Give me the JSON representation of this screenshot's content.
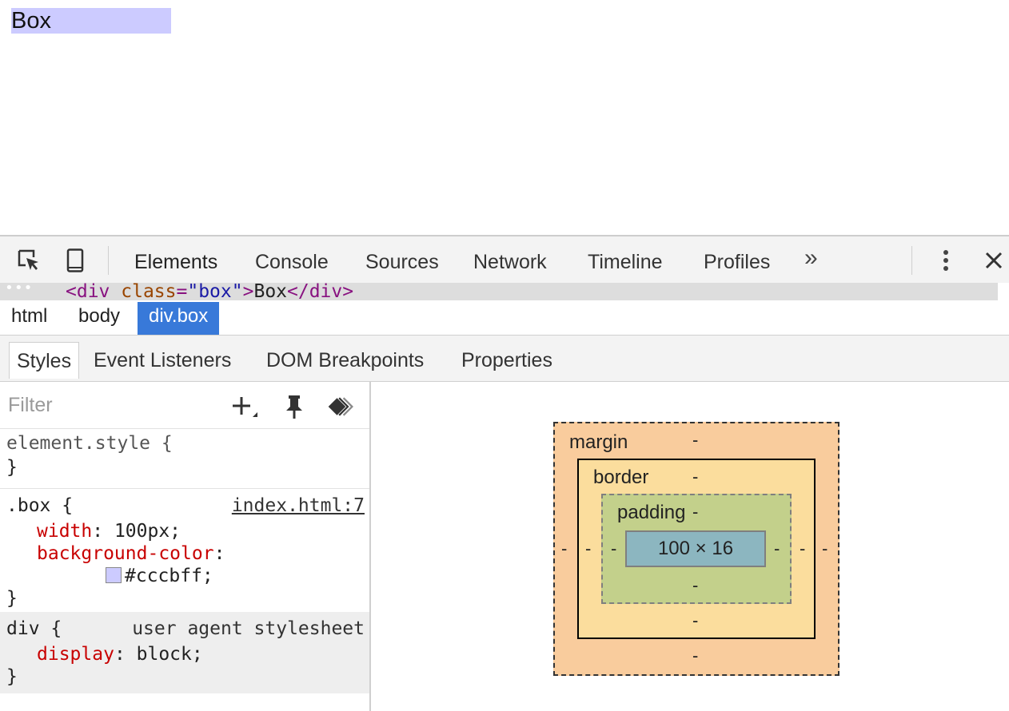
{
  "page": {
    "box_text": "Box",
    "box_color": "#cccbff"
  },
  "toolbar": {
    "inspect_icon": "inspect-element-icon",
    "device_icon": "device-mode-icon",
    "tabs": [
      {
        "label": "Elements",
        "active": true
      },
      {
        "label": "Console"
      },
      {
        "label": "Sources"
      },
      {
        "label": "Network"
      },
      {
        "label": "Timeline"
      },
      {
        "label": "Profiles"
      }
    ],
    "more_label": "»",
    "menu_icon": "vertical-dots-icon",
    "close_icon": "close-icon"
  },
  "dom": {
    "dots": "•••",
    "open_tag": "<div",
    "attr_name": "class",
    "eq": "=",
    "attr_value": "\"box\"",
    "close_bracket": ">",
    "text": "Box",
    "end_tag": "</div>"
  },
  "breadcrumbs": [
    "html",
    "body",
    "div.box"
  ],
  "subtabs": [
    {
      "label": "Styles",
      "active": true
    },
    {
      "label": "Event Listeners"
    },
    {
      "label": "DOM Breakpoints"
    },
    {
      "label": "Properties"
    }
  ],
  "styles": {
    "filter_placeholder": "Filter",
    "rules": {
      "element_style": {
        "selector": "element.style {",
        "close": "}"
      },
      "box": {
        "selector": ".box {",
        "source": "index.html:7",
        "width_prop": "width",
        "width_val": ": 100px;",
        "bg_prop": "background-color",
        "bg_colon": ":",
        "bg_val": "#cccbff;",
        "swatch_color": "#cccbff",
        "close": "}"
      },
      "div": {
        "selector": "div {",
        "origin": "user agent stylesheet",
        "display_prop": "display",
        "display_val": ": block;",
        "close": "}"
      }
    }
  },
  "metrics": {
    "margin_label": "margin",
    "border_label": "border",
    "padding_label": "padding",
    "dash": "-",
    "content_size": "100 × 16",
    "colors": {
      "margin": "#f9cc9d",
      "border": "#fbdd9d",
      "padding": "#c3d08b",
      "content": "#8cb6c0"
    }
  }
}
